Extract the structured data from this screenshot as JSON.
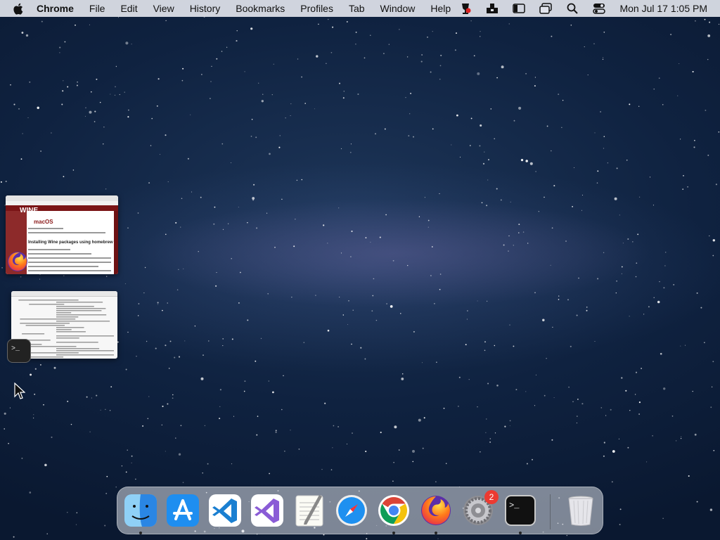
{
  "menubar": {
    "app_name": "Chrome",
    "items": [
      "File",
      "Edit",
      "View",
      "History",
      "Bookmarks",
      "Profiles",
      "Tab",
      "Window",
      "Help"
    ],
    "clock": "Mon Jul 17  1:05 PM",
    "status_icons": [
      "wine-icon",
      "dock-stack-icon",
      "sidebar-icon",
      "window-icon",
      "search-icon",
      "control-center-icon"
    ]
  },
  "thumbnails": [
    {
      "app": "Firefox",
      "heading_logo": "WINE",
      "title": "macOS",
      "heading": "Installing Wine packages using homebrew"
    },
    {
      "app": "Terminal"
    }
  ],
  "dock": {
    "apps": [
      {
        "name": "Finder",
        "icon": "finder-icon",
        "running": true
      },
      {
        "name": "App Store",
        "icon": "app-store-icon",
        "running": false
      },
      {
        "name": "Visual Studio Code",
        "icon": "vscode-icon",
        "running": false
      },
      {
        "name": "Visual Studio",
        "icon": "visual-studio-icon",
        "running": false
      },
      {
        "name": "TextEdit",
        "icon": "textedit-icon",
        "running": false
      },
      {
        "name": "Safari",
        "icon": "safari-icon",
        "running": false
      },
      {
        "name": "Google Chrome",
        "icon": "chrome-icon",
        "running": true
      },
      {
        "name": "Firefox",
        "icon": "firefox-icon",
        "running": true
      },
      {
        "name": "System Preferences",
        "icon": "system-preferences-icon",
        "running": false,
        "badge": "2"
      },
      {
        "name": "Terminal",
        "icon": "terminal-icon",
        "running": true
      },
      {
        "name": "Trash",
        "icon": "trash-icon",
        "running": false
      }
    ]
  },
  "colors": {
    "menubar_bg": "#e1e4ec",
    "badge": "#ec3a31",
    "wine_red": "#7a1416"
  }
}
